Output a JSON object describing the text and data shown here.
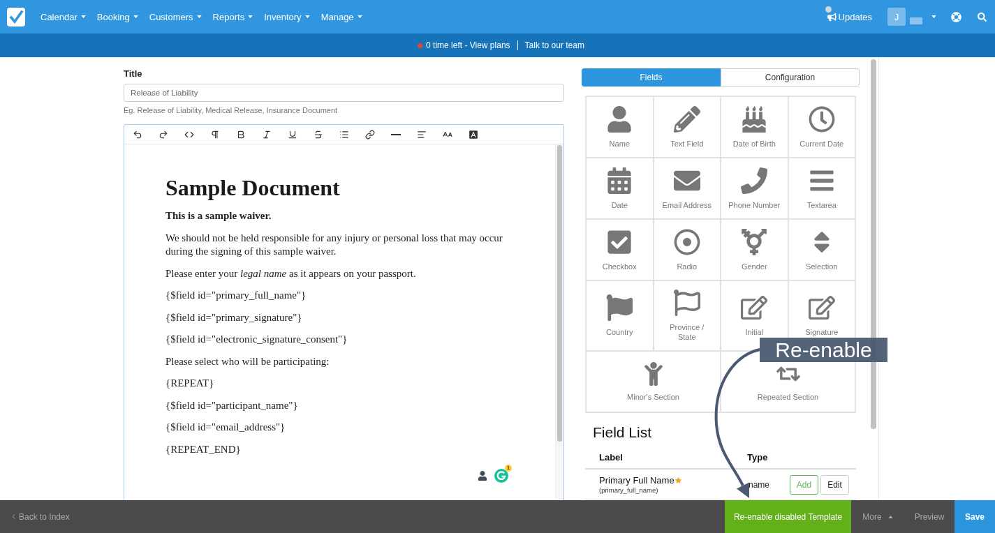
{
  "nav": {
    "menus": [
      {
        "label": "Calendar"
      },
      {
        "label": "Booking"
      },
      {
        "label": "Customers"
      },
      {
        "label": "Reports"
      },
      {
        "label": "Inventory"
      },
      {
        "label": "Manage"
      }
    ],
    "updates": "Updates",
    "user_initial": "J"
  },
  "notice_bar": {
    "plan": "0 time left - View plans",
    "contact": "Talk to our team"
  },
  "title_field": {
    "label": "Title",
    "value": "Release of Liability",
    "hint": "Eg. Release of Liability, Medical Release, Insurance Document"
  },
  "document": {
    "heading": "Sample Document",
    "paragraphs": [
      {
        "kind": "lead",
        "text": "This is a sample waiver."
      },
      {
        "kind": "body",
        "text": "We should not be held responsible for any injury or personal loss that may occur during the signing of this sample waiver."
      },
      {
        "kind": "body",
        "text": "Please enter your *legal name* as it appears on your passport."
      },
      {
        "kind": "body",
        "text": "{$field id=\"primary_full_name\"}"
      },
      {
        "kind": "body",
        "text": "{$field id=\"primary_signature\"}"
      },
      {
        "kind": "body",
        "text": "{$field id=\"electronic_signature_consent\"}"
      },
      {
        "kind": "body",
        "text": "Please select who will be participating:"
      },
      {
        "kind": "body",
        "text": "{REPEAT}"
      },
      {
        "kind": "body",
        "text": "{$field id=\"participant_name\"}"
      },
      {
        "kind": "body",
        "text": "{$field id=\"email_address\"}"
      },
      {
        "kind": "body",
        "text": "{REPEAT_END}"
      }
    ],
    "assistant_badge": "1"
  },
  "tabs": [
    {
      "label": "Fields",
      "selected": true
    },
    {
      "label": "Configuration",
      "selected": false
    }
  ],
  "fields": [
    {
      "label": "Name",
      "kind": "field"
    },
    {
      "label": "Text Field",
      "kind": "field"
    },
    {
      "label": "Date of Birth",
      "kind": "field"
    },
    {
      "label": "Current Date",
      "kind": "field"
    },
    {
      "label": "Date",
      "kind": "field"
    },
    {
      "label": "Email Address",
      "kind": "field"
    },
    {
      "label": "Phone Number",
      "kind": "field"
    },
    {
      "label": "Textarea",
      "kind": "field"
    },
    {
      "label": "Checkbox",
      "kind": "field"
    },
    {
      "label": "Radio",
      "kind": "field"
    },
    {
      "label": "Gender",
      "kind": "field"
    },
    {
      "label": "Selection",
      "kind": "field"
    },
    {
      "label": "Country",
      "kind": "field"
    },
    {
      "label": "Province / State",
      "kind": "field"
    },
    {
      "label": "Initial",
      "kind": "field"
    },
    {
      "label": "Signature",
      "kind": "field"
    },
    {
      "label": "Minor's Section",
      "kind": "section"
    },
    {
      "label": "Repeated Section",
      "kind": "section"
    }
  ],
  "field_list": {
    "title": "Field List",
    "columns": [
      "Label",
      "Type"
    ],
    "rows": [
      {
        "label": "Primary Full Name",
        "required": true,
        "key": "(primary_full_name)",
        "type": "name",
        "actions": [
          {
            "label": "Add",
            "kind": "add"
          },
          {
            "label": "Edit",
            "kind": "edit"
          }
        ]
      }
    ]
  },
  "annotation": "Re-enable",
  "footer": {
    "back": "Back to Index",
    "primary_action": "Re-enable disabled Template",
    "more": "More",
    "preview": "Preview",
    "save": "Save"
  }
}
